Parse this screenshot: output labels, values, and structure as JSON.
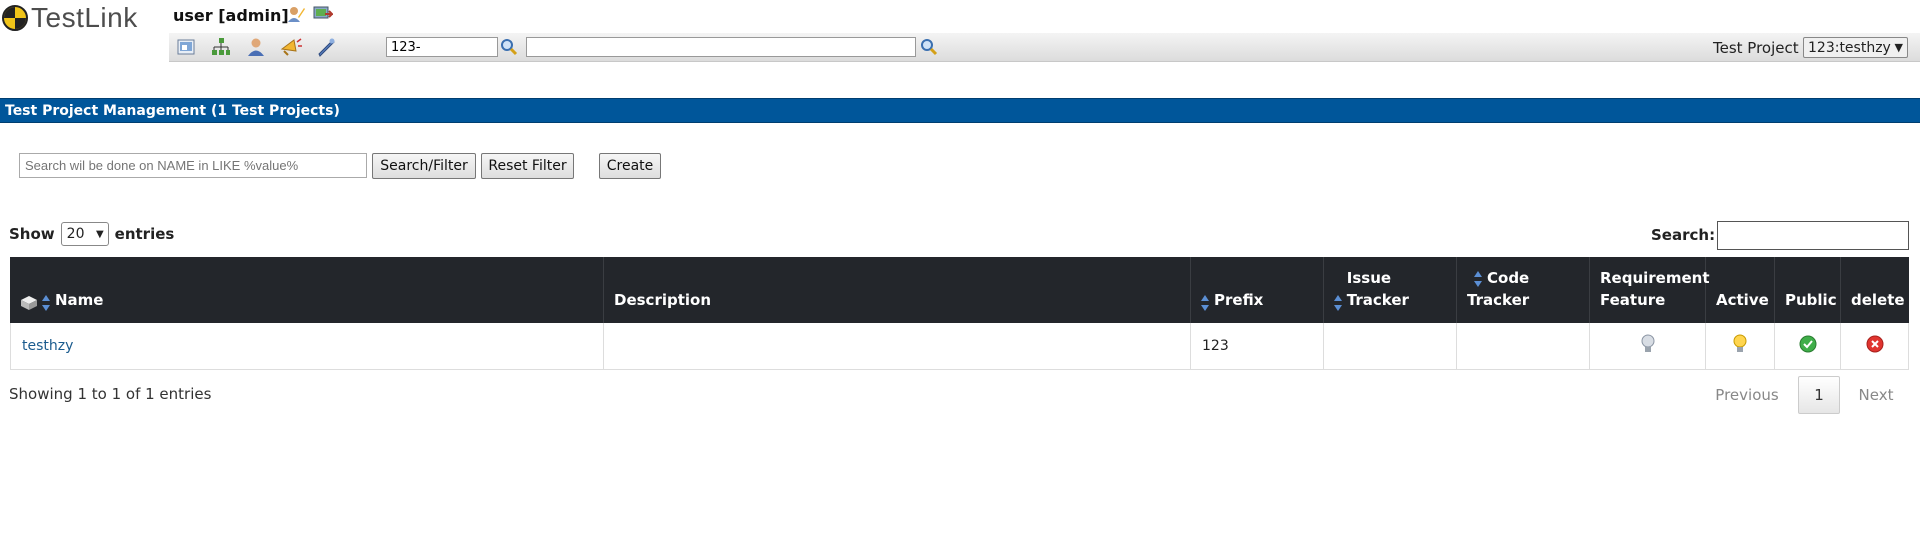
{
  "app": {
    "name": "TestLink"
  },
  "header": {
    "user_label": "user [admin]",
    "icons": [
      "user-edit-icon",
      "logout-icon"
    ],
    "toolbar_icons": [
      "home-icon",
      "project-tree-icon",
      "user-icon",
      "events-icon",
      "settings-icon"
    ],
    "testcase_input_value": "123-",
    "search_input_value": "",
    "test_project_label": "Test Project",
    "test_project_selected": "123:testhzy"
  },
  "page": {
    "title": "Test Project Management (1 Test Projects)",
    "filter_placeholder": "Search wil be done on NAME in LIKE %value%",
    "search_filter_label": "Search/Filter",
    "reset_filter_label": "Reset Filter",
    "create_label": "Create"
  },
  "table": {
    "show_label": "Show",
    "entries_count": "20",
    "entries_label": "entries",
    "search_label": "Search:",
    "columns": {
      "name": "Name",
      "description": "Description",
      "prefix": "Prefix",
      "issue_tracker": "Issue Tracker",
      "code_tracker": "Code Tracker",
      "requirement_feature": "Requirement Feature",
      "active": "Active",
      "public": "Public",
      "delete": "delete"
    },
    "rows": [
      {
        "name": "testhzy",
        "description": "",
        "prefix": "123",
        "issue_tracker": "",
        "code_tracker": ""
      }
    ],
    "info": "Showing 1 to 1 of 1 entries",
    "pagination": {
      "previous": "Previous",
      "current": "1",
      "next": "Next"
    }
  },
  "colors": {
    "titlebar": "#00569a",
    "table_header": "#23262b",
    "link": "#1a5b8e"
  }
}
